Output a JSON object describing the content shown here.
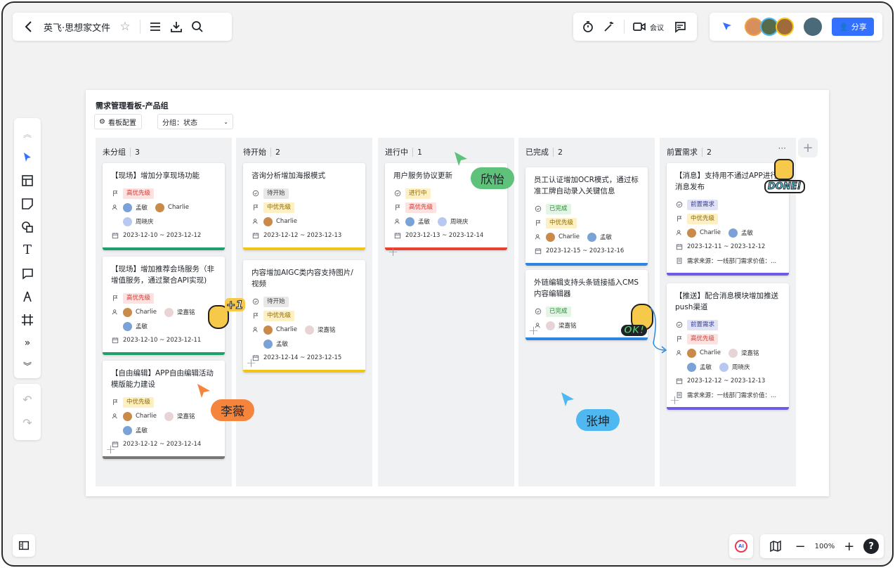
{
  "header": {
    "back": "<",
    "title": "英飞·思想家文件"
  },
  "topright": {
    "meeting_label": "会议",
    "share_label": "分享"
  },
  "board": {
    "title": "需求管理看板-产品组",
    "config_label": "看板配置",
    "group_label": "分组：状态"
  },
  "columns": [
    {
      "name": "未分组",
      "count": "3",
      "cards": [
        {
          "title": "【现场】增加分享现场功能",
          "tag": "高优先级",
          "tagc": "hi",
          "people": [
            "孟敏",
            "Charlie",
            "周晓庆"
          ],
          "date": "2023-12-10 ~ 2023-12-12",
          "bar": "#1e9f6b"
        },
        {
          "title": "【现场】增加推荐会场服务（非增值服务，通过聚合API实现)",
          "tag": "高优先级",
          "tagc": "hi",
          "people": [
            "Charlie",
            "梁嘉铭",
            "孟敏"
          ],
          "date": "2023-12-10 ~ 2023-12-11",
          "bar": "#1e9f6b"
        },
        {
          "title": "【自由编辑】APP自由编辑活动模版能力建设",
          "tag": "中优先级",
          "tagc": "mid",
          "people": [
            "Charlie",
            "梁嘉铭",
            "孟敏"
          ],
          "date": "2023-12-12 ~ 2023-12-14",
          "bar": "#777"
        }
      ]
    },
    {
      "name": "待开始",
      "count": "2",
      "cards": [
        {
          "title": "咨询分析增加海报模式",
          "status": "待开始",
          "tag": "中优先级",
          "tagc": "mid",
          "people": [
            "Charlie"
          ],
          "date": "2023-12-12 ~ 2023-12-13",
          "bar": "#f0c419"
        },
        {
          "title": "内容增加AIGC类内容支持图片/视频",
          "status": "待开始",
          "tag": "中优先级",
          "tagc": "mid",
          "people": [
            "Charlie",
            "梁嘉铭",
            "孟敏"
          ],
          "date": "2023-12-14 ~ 2023-12-15",
          "bar": "#f0c419"
        }
      ]
    },
    {
      "name": "进行中",
      "count": "1",
      "cards": [
        {
          "title": "用户服务协议更新",
          "status": "进行中",
          "tag": "高优先级",
          "tagc": "hi",
          "people": [
            "孟敏",
            "周晓庆"
          ],
          "date": "2023-12-13 ~ 2023-12-14",
          "bar": "#e8412f"
        }
      ]
    },
    {
      "name": "已完成",
      "count": "2",
      "cards": [
        {
          "title": "员工认证增加OCR模式，通过标准工牌自动录入关键信息",
          "status": "已完成",
          "tag": "中优先级",
          "tagc": "mid",
          "people": [
            "Charlie",
            "孟敏"
          ],
          "date": "2023-12-15 ~ 2023-12-16",
          "bar": "#2e86de"
        },
        {
          "title": "外链编辑支持头条链接插入CMS内容编辑器",
          "status": "已完成",
          "people": [
            "梁嘉铭"
          ],
          "bar": "#2e86de"
        }
      ]
    },
    {
      "name": "前置需求",
      "count": "2",
      "cards": [
        {
          "title": "【消息】支持用不通过APP进行消息发布",
          "status": "前置需求",
          "tag": "中优先级",
          "tagc": "mid",
          "people": [
            "Charlie",
            "孟敏"
          ],
          "date": "2023-12-11 ~ 2023-12-12",
          "src": "需求来源：一线部门需求价值：...",
          "bar": "#6c5ce7"
        },
        {
          "title": "【推送】配合消息模块增加推送push渠道",
          "status": "前置需求",
          "tag": "高优先级",
          "tagc": "hi",
          "people": [
            "Charlie",
            "梁嘉铭",
            "孟敏",
            "周晓庆"
          ],
          "date": "2023-12-12 ~ 2023-12-13",
          "src": "需求来源：一线部门需求价值：...",
          "bar": "#6c5ce7"
        }
      ]
    }
  ],
  "cursors": {
    "xinyi": "欣怡",
    "liwei": "李薇",
    "zhangkun": "张坤"
  },
  "stickers": {
    "plus_one": "+1",
    "done": "DONE!",
    "ok": "OK!"
  },
  "bottom": {
    "zoom": "100%",
    "ai": "AI",
    "help": "?"
  },
  "colors": {
    "accent": "#3370ff",
    "xinyi": "#5ec27a",
    "liwei": "#f5843c",
    "zhangkun": "#4fb8f0"
  }
}
